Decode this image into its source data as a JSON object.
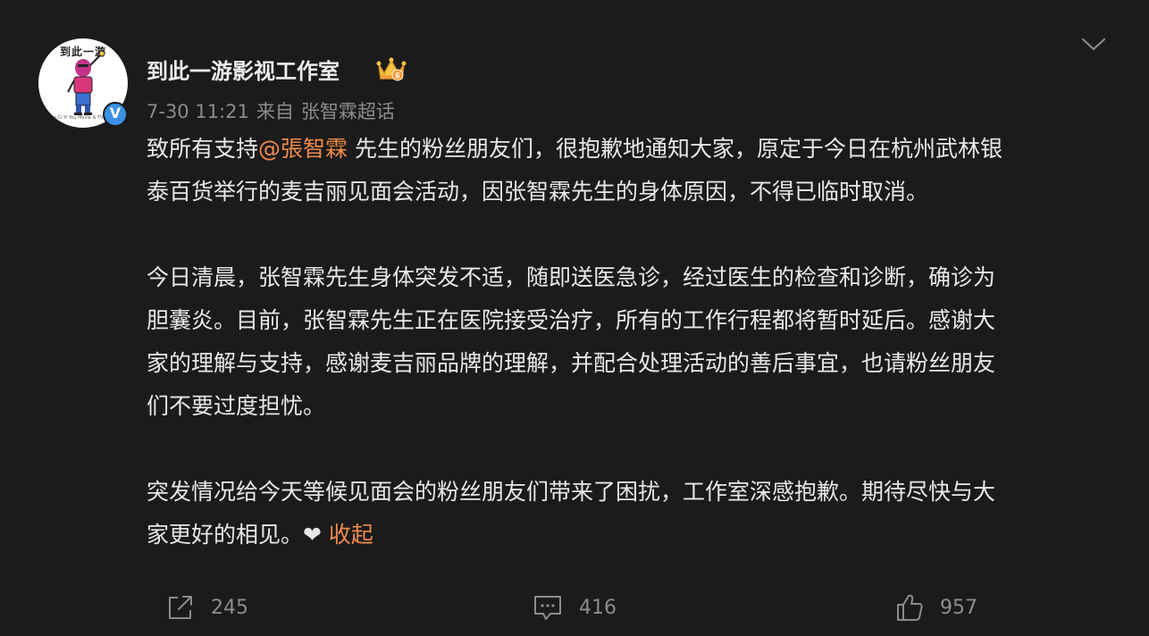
{
  "post": {
    "username": "到此一游影视工作室",
    "avatar": {
      "logo_text": "到此一游",
      "logo_sub": "Dao Ci Yi You Movie & TV Co.Ltd"
    },
    "verified_icon": "V",
    "timestamp": "7-30 11:21",
    "source_prefix": "来自",
    "source": "张智霖超话",
    "paragraphs": [
      {
        "lines": [
          {
            "pre": "致所有支持",
            "mention": "@張智霖",
            "post": " 先生的粉丝朋友们，很抱歉地通知大家，原定于今日在杭州武林银"
          },
          {
            "text": "泰百货举行的麦吉丽见面会活动，因张智霖先生的身体原因，不得已临时取消。"
          }
        ]
      },
      {
        "lines": [
          {
            "text": "今日清晨，张智霖先生身体突发不适，随即送医急诊，经过医生的检查和诊断，确诊为"
          },
          {
            "text": "胆囊炎。目前，张智霖先生正在医院接受治疗，所有的工作行程都将暂时延后。感谢大"
          },
          {
            "text": "家的理解与支持，感谢麦吉丽品牌的理解，并配合处理活动的善后事宜，也请粉丝朋友"
          },
          {
            "text": "们不要过度担忧。"
          }
        ]
      },
      {
        "lines": [
          {
            "text": "突发情况给今天等候见面会的粉丝朋友们带来了困扰，工作室深感抱歉。期待尽快与大"
          },
          {
            "text": "家更好的相见。"
          }
        ]
      }
    ],
    "heart_glyph": "❤",
    "collapse_label": "收起",
    "actions": {
      "share_count": "245",
      "comment_count": "416",
      "like_count": "957"
    }
  },
  "icons": {
    "share": "share-icon",
    "comment": "comment-icon",
    "like": "thumbs-up-icon",
    "menu": "chevron-down-icon",
    "crown": "crown-badge-icon",
    "verified": "verified-badge-icon"
  },
  "colors": {
    "background": "#1b1b1c",
    "text": "#e8e8e8",
    "muted": "#8c8c8c",
    "accent": "#f08a4a",
    "verified": "#3a90e6"
  }
}
